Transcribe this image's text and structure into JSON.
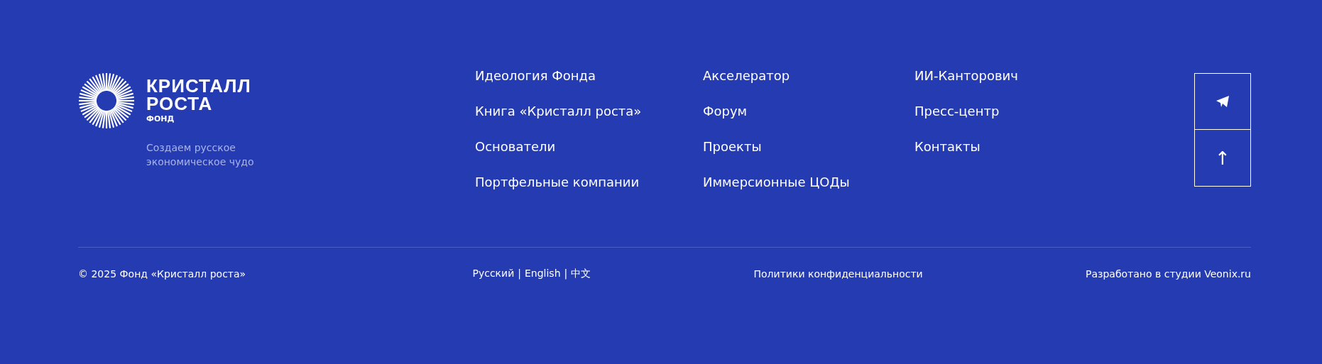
{
  "brand": {
    "name_line_1": "КРИСТАЛЛ",
    "name_line_2": "РОСТА",
    "subtitle": "ФОНД",
    "tagline": "Создаем русское экономическое чудо"
  },
  "nav_columns": [
    {
      "links": [
        "Идеология Фонда",
        "Книга «Кристалл роста»",
        "Основатели",
        "Портфельные компании"
      ]
    },
    {
      "links": [
        "Акселератор",
        "Форум",
        "Проекты",
        "Иммерсионные ЦОДы"
      ]
    },
    {
      "links": [
        "ИИ-Канторович",
        "Пресс-центр",
        "Контакты"
      ]
    }
  ],
  "side_buttons": [
    {
      "kind": "telegram"
    },
    {
      "kind": "up",
      "label": "↑"
    }
  ],
  "bottom": {
    "copyright": "© 2025 Фонд «Кристалл роста»",
    "languages": [
      "Русский",
      "English",
      "中文"
    ],
    "separator": "|",
    "privacy": "Политики конфиденциальности",
    "credit": "Разработано в студии Veonix.ru"
  }
}
